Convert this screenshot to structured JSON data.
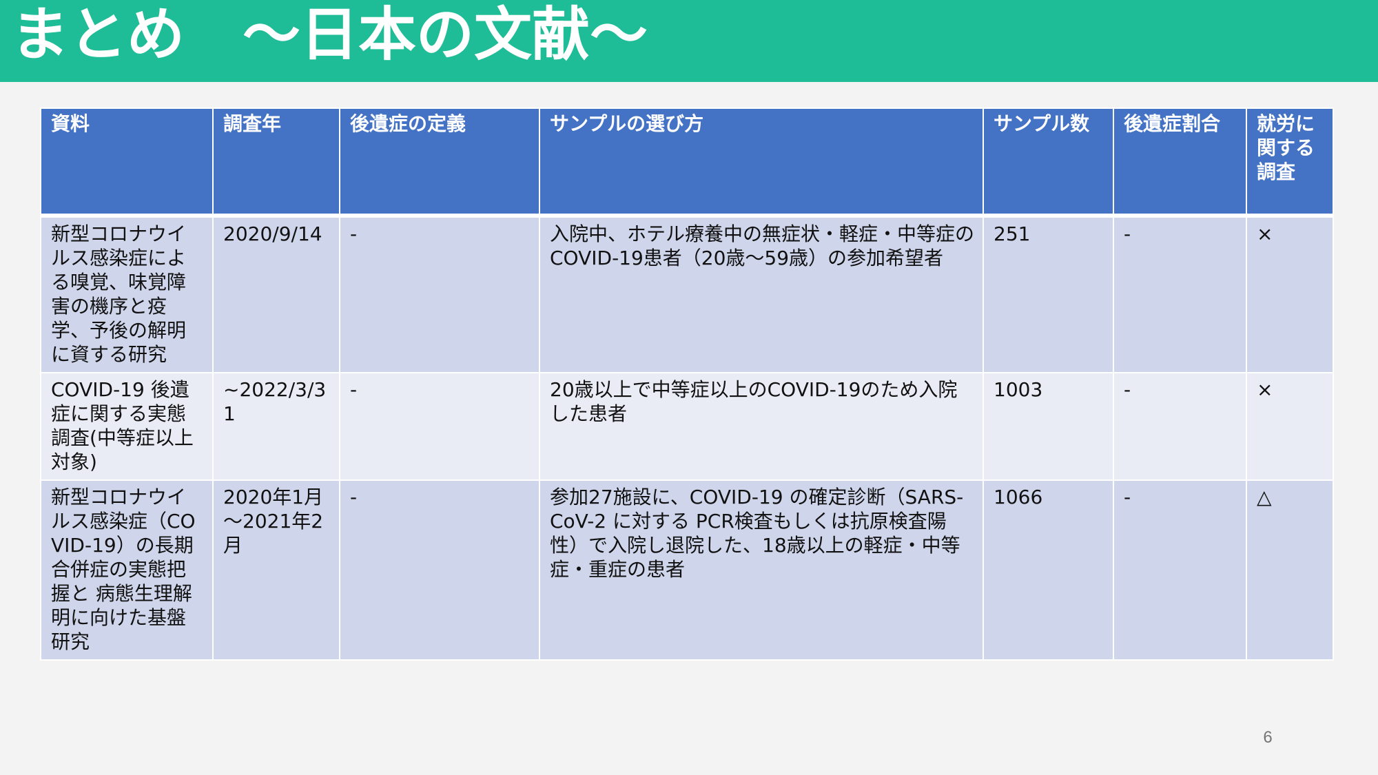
{
  "slide": {
    "title": "まとめ　～日本の文献～",
    "page_number": "6"
  },
  "colors": {
    "title_bar": "#1fbd97",
    "header_fill": "#4472c4",
    "row_fill_dark": "#cfd5ea",
    "row_fill_light": "#e9ebf5"
  },
  "table": {
    "headers": [
      "資料",
      "調査年",
      "後遺症の定義",
      "サンプルの選び方",
      "サンプル数",
      "後遺症割合",
      "就労に関する調査"
    ],
    "rows": [
      [
        "新型コロナウイルス感染症による嗅覚、味覚障害の機序と疫学、予後の解明に資する研究",
        "2020/9/14",
        "-",
        "入院中、ホテル療養中の無症状・軽症・中等症のCOVID-19患者（20歳～59歳）の参加希望者",
        "251",
        "-",
        "×"
      ],
      [
        "COVID-19 後遺症に関する実態調査(中等症以上対象)",
        "~2022/3/31",
        "-",
        "20歳以上で中等症以上のCOVID-19のため入院した患者",
        "1003",
        "-",
        "×"
      ],
      [
        "新型コロナウイルス感染症（COVID-19）の長期合併症の実態把握と 病態生理解明に向けた基盤研究",
        "2020年1月～2021年2月",
        "-",
        "参加27施設に、COVID-19 の確定診断（SARS-CoV-2 に対する PCR検査もしくは抗原検査陽性）で入院し退院した、18歳以上の軽症・中等症・重症の患者",
        "1066",
        "-",
        "△"
      ]
    ]
  }
}
